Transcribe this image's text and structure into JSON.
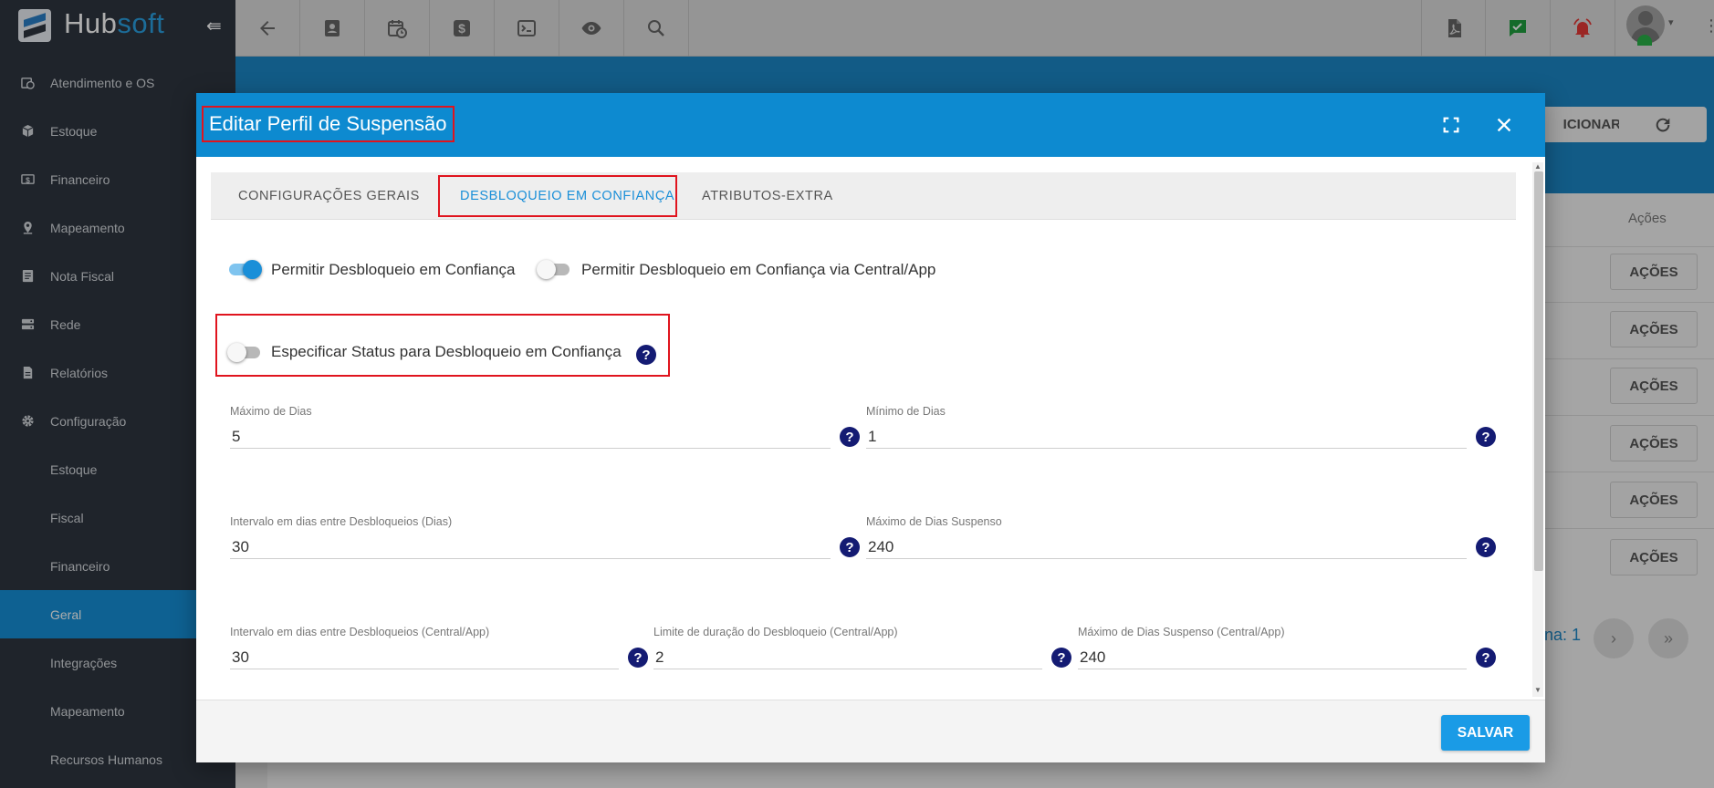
{
  "brand": {
    "part1": "Hub",
    "part2": "soft"
  },
  "colors": {
    "brand_blue": "#1a8fd8",
    "sidebar": "#2f3640",
    "highlight_red": "#e0141e",
    "help_navy": "#141b73",
    "save_button": "#1a9be6"
  },
  "topbar": {
    "icons": [
      "arrow-left-icon",
      "contact-card-icon",
      "calendar-clock-icon",
      "dollar-icon",
      "terminal-icon",
      "eye-icon",
      "search-icon",
      "pdf-icon",
      "chat-check-icon",
      "alarm-icon"
    ]
  },
  "sidebar": {
    "items": [
      {
        "label": "Atendimento e OS",
        "icon": "calendar-clock-icon"
      },
      {
        "label": "Estoque",
        "icon": "box-icon"
      },
      {
        "label": "Financeiro",
        "icon": "dollar-icon"
      },
      {
        "label": "Mapeamento",
        "icon": "map-pin-icon"
      },
      {
        "label": "Nota Fiscal",
        "icon": "document-icon"
      },
      {
        "label": "Rede",
        "icon": "server-icon"
      },
      {
        "label": "Relatórios",
        "icon": "report-icon"
      },
      {
        "label": "Configuração",
        "icon": "gear-icon"
      }
    ],
    "subitems": [
      {
        "label": "Estoque"
      },
      {
        "label": "Fiscal"
      },
      {
        "label": "Financeiro"
      },
      {
        "label": "Geral",
        "active": true
      },
      {
        "label": "Integrações"
      },
      {
        "label": "Mapeamento"
      },
      {
        "label": "Recursos Humanos"
      }
    ]
  },
  "background": {
    "adicionar_label": "ICIONAR",
    "acoes_header": "Ações",
    "acoes_button": "AÇÕES",
    "pagina_label": "ina: 1",
    "next_glyph": "›",
    "last_glyph": "»"
  },
  "modal": {
    "title": "Editar Perfil de Suspensão",
    "tabs": [
      {
        "label": "CONFIGURAÇÕES GERAIS",
        "active": false
      },
      {
        "label": "DESBLOQUEIO EM CONFIANÇA",
        "active": true
      },
      {
        "label": "ATRIBUTOS-EXTRA",
        "active": false
      }
    ],
    "toggles": {
      "permitir": {
        "label": "Permitir Desbloqueio em Confiança",
        "on": true
      },
      "permitir_app": {
        "label": "Permitir Desbloqueio em Confiança via Central/App",
        "on": false
      },
      "especificar": {
        "label": "Especificar Status para Desbloqueio em Confiança",
        "on": false
      }
    },
    "help_glyph": "?",
    "fields": {
      "max_dias": {
        "label": "Máximo de Dias",
        "value": "5"
      },
      "min_dias": {
        "label": "Mínimo de Dias",
        "value": "1"
      },
      "intervalo": {
        "label": "Intervalo em dias entre Desbloqueios (Dias)",
        "value": "30"
      },
      "max_suspenso": {
        "label": "Máximo de Dias Suspenso",
        "value": "240"
      },
      "intervalo_app": {
        "label": "Intervalo em dias entre Desbloqueios (Central/App)",
        "value": "30"
      },
      "limite_app": {
        "label": "Limite de duração do Desbloqueio (Central/App)",
        "value": "2"
      },
      "max_suspenso_app": {
        "label": "Máximo de Dias Suspenso (Central/App)",
        "value": "240"
      }
    },
    "save_label": "SALVAR"
  }
}
